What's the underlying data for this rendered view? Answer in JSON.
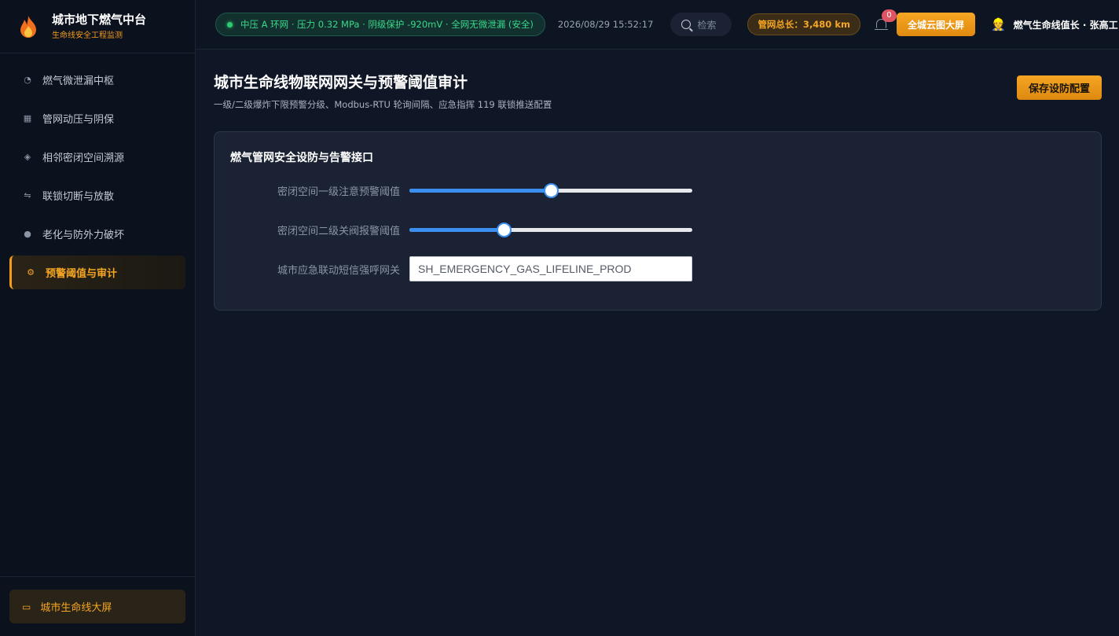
{
  "brand": {
    "title": "城市地下燃气中台",
    "subtitle": "生命线安全工程监测"
  },
  "sidebar": {
    "items": [
      {
        "label": "燃气微泄漏中枢",
        "icon": "gauge-icon",
        "glyph": "◔",
        "active": false
      },
      {
        "label": "管网动压与阴保",
        "icon": "chart-icon",
        "glyph": "▦",
        "active": false
      },
      {
        "label": "相邻密闭空间溯源",
        "icon": "target-icon",
        "glyph": "◈",
        "active": false
      },
      {
        "label": "联锁切断与放散",
        "icon": "swap-icon",
        "glyph": "⇋",
        "active": false
      },
      {
        "label": "老化与防外力破坏",
        "icon": "alert-icon",
        "glyph": "●",
        "active": false
      },
      {
        "label": "预警阈值与审计",
        "icon": "gear-icon",
        "glyph": "⚙",
        "active": true
      }
    ],
    "footer_label": "城市生命线大屏"
  },
  "topbar": {
    "status": "中压 A 环网 · 压力 0.32 MPa · 阴级保护 -920mV · 全网无微泄漏 (安全)",
    "datetime": "2026/08/29 15:52:17",
    "search_placeholder": "检索",
    "network_length": "管网总长：3,480 km",
    "notification_count": "0",
    "big_screen_label": "全城云图大屏",
    "user_name": "燃气生命线值长 · 张高工"
  },
  "page": {
    "title": "城市生命线物联网网关与预警阈值审计",
    "subtitle": "一级/二级爆炸下限预警分级、Modbus-RTU 轮询间隔、应急指挥 119 联锁推送配置",
    "save_label": "保存设防配置"
  },
  "card": {
    "title": "燃气管网安全设防与告警接口",
    "level1_label": "密闭空间一级注意预警阈值",
    "level1_value": 0.5,
    "level2_label": "密闭空间二级关阀报警阈值",
    "level2_value": 0.333,
    "gateway_label": "城市应急联动短信强呼网关",
    "gateway_value": "SH_EMERGENCY_GAS_LIFELINE_PROD"
  },
  "colors": {
    "accent": "#f5a623",
    "safe": "#39d98a",
    "slider": "#3b8ff0",
    "badge": "#e05563"
  }
}
